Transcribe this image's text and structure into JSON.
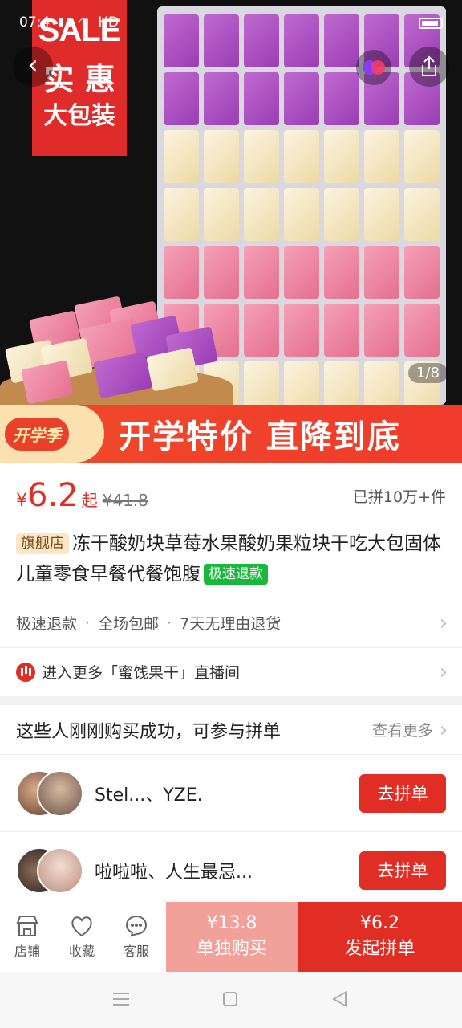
{
  "status_bar": {
    "time": "07:4",
    "network": "HD"
  },
  "hero": {
    "sale_badge": {
      "line1": "SALE",
      "line2": "实 惠",
      "line3": "大包装"
    },
    "image_counter": "1/8",
    "cube_colors": [
      "purple",
      "purple",
      "yellow",
      "yellow",
      "pink",
      "pink",
      "yellow"
    ]
  },
  "promo": {
    "badge": "开学季",
    "text": "开学特价  直降到底"
  },
  "product": {
    "currency": "¥",
    "price": "6.2",
    "price_suffix": "起",
    "original_price": "¥41.8",
    "sold": "已拼10万+件",
    "shop_tag": "旗舰店",
    "title": "冻干酸奶块草莓水果酸奶果粒块干吃大包固体儿童零食早餐代餐饱腹",
    "refund_tag": "极速退款",
    "services": [
      "极速退款",
      "全场包邮",
      "7天无理由退货"
    ],
    "live_entry": "进入更多「蜜饯果干」直播间"
  },
  "group_buy": {
    "heading": "这些人刚刚购买成功，可参与拼单",
    "more": "查看更多",
    "rows": [
      {
        "names": "Stel...、YZE.",
        "button": "去拼单"
      },
      {
        "names": "啦啦啦、人生最忌...",
        "button": "去拼单"
      }
    ]
  },
  "action_bar": {
    "store": "店铺",
    "favorite": "收藏",
    "service": "客服",
    "single_price": "¥13.8",
    "single_label": "单独购买",
    "group_price": "¥6.2",
    "group_label": "发起拼单"
  },
  "colors": {
    "accent": "#e02e24",
    "promo": "#f04a2a",
    "refund_tag": "#18b93a"
  }
}
